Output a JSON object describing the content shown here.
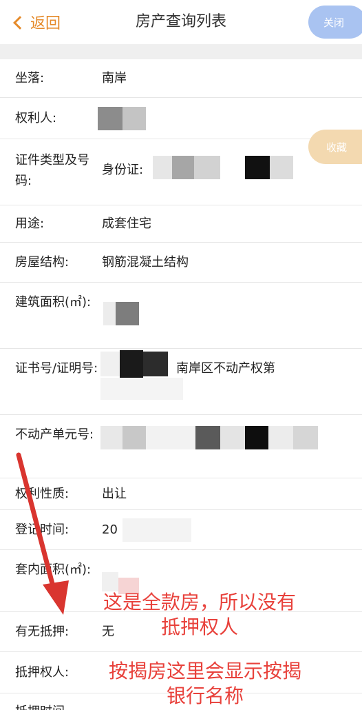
{
  "header": {
    "back_label": "返回",
    "title": "房产查询列表",
    "close_label": "关闭"
  },
  "float_button": {
    "label": "收藏"
  },
  "fields": [
    {
      "label": "坐落:",
      "value": "南岸"
    },
    {
      "label": "权利人:",
      "value": ""
    },
    {
      "label": "证件类型及号码:",
      "value": "身份证:"
    },
    {
      "label": "用途:",
      "value": "成套住宅"
    },
    {
      "label": "房屋结构:",
      "value": "钢筋混凝土结构"
    },
    {
      "label": "建筑面积(㎡):",
      "value": ""
    },
    {
      "label": "证书号/证明号:",
      "value": "南岸区不动产权第"
    },
    {
      "label": "不动产单元号:",
      "value": ""
    },
    {
      "label": "权利性质:",
      "value": "出让"
    },
    {
      "label": "登记时间:",
      "value": "20"
    },
    {
      "label": "套内面积(㎡):",
      "value": ""
    },
    {
      "label": "有无抵押:",
      "value": "无"
    },
    {
      "label": "抵押权人:",
      "value": ""
    },
    {
      "label": "抵押时间",
      "value": ""
    }
  ],
  "annotations": {
    "note1_line1": "这是全款房，所以没有",
    "note1_line2": "抵押权人",
    "note2_line1": "按揭房这里会显示按揭",
    "note2_line2": "银行名称"
  },
  "colors": {
    "accent": "#e58a2a",
    "close_btn": "#a9c3f1",
    "annotation": "#e8413b"
  }
}
